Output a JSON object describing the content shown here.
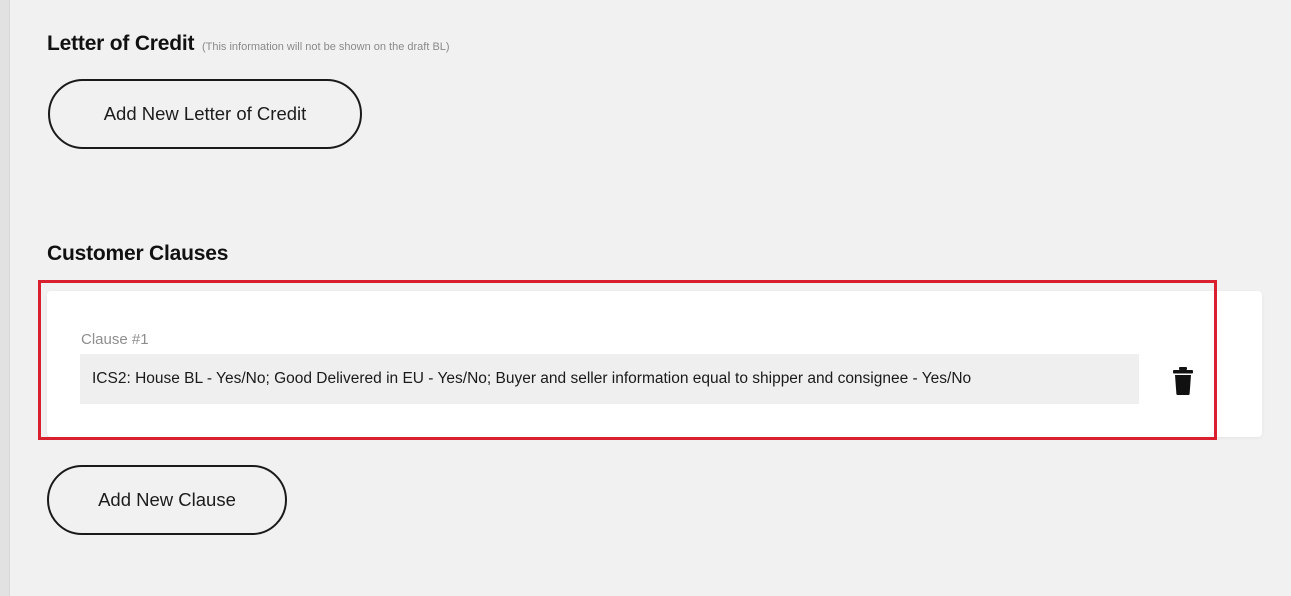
{
  "letter_of_credit": {
    "title": "Letter of Credit",
    "note": "(This information will not be shown on the draft BL)",
    "add_button_label": "Add New Letter of Credit"
  },
  "customer_clauses": {
    "title": "Customer Clauses",
    "clauses": [
      {
        "label": "Clause #1",
        "value": "ICS2: House BL - Yes/No; Good Delivered in EU - Yes/No; Buyer and seller information equal to shipper and consignee - Yes/No"
      }
    ],
    "delete_icon": "trash-icon",
    "add_button_label": "Add New Clause"
  },
  "highlight_color": "#d8202e"
}
